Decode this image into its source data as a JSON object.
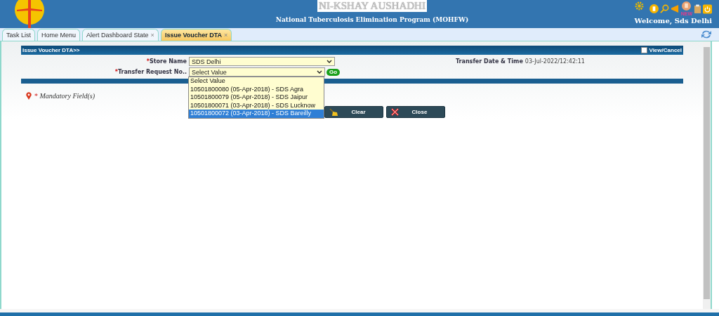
{
  "header": {
    "title": "NI-KSHAY AUSHADHI",
    "subtitle": "National Tuberculosis Elimination Program (MOHFW)",
    "new_badge": "NEW",
    "welcome": "Welcome, Sds Delhi"
  },
  "tabs": [
    {
      "label": "Task List",
      "selected": false,
      "closable": false
    },
    {
      "label": "Home Menu",
      "selected": false,
      "closable": false
    },
    {
      "label": "Alert Dashboard State",
      "selected": false,
      "closable": true
    },
    {
      "label": "Issue Voucher DTA",
      "selected": true,
      "closable": true
    }
  ],
  "close_glyph": "×",
  "form": {
    "title": "Issue Voucher DTA>>",
    "view_cancel": {
      "label": "View/Cancel",
      "checked": false
    },
    "store_name": {
      "label": "Store Name",
      "value": "SDS Delhi"
    },
    "transfer_request": {
      "label": "Transfer Request No..",
      "value": "Select Value",
      "go": "Go"
    },
    "transfer_date": {
      "label": "Transfer Date & Time",
      "value": "03-Jul-2022/12:42:11"
    },
    "required_mark": "*",
    "dropdown_options": [
      {
        "label": "Select Value",
        "selected": false
      },
      {
        "label": "10501800080 (05-Apr-2018) - SDS Agra",
        "selected": false
      },
      {
        "label": "10501800079 (05-Apr-2018) - SDS Jaipur",
        "selected": false
      },
      {
        "label": "10501800071 (03-Apr-2018) - SDS Lucknow",
        "selected": false
      },
      {
        "label": "10501800072 (03-Apr-2018) - SDS Bareilly",
        "selected": true
      }
    ],
    "mandatory_note": "Mandatory Field(s)",
    "buttons": [
      {
        "kind": "clear",
        "label": "Clear"
      },
      {
        "kind": "close",
        "label": "Close"
      }
    ]
  }
}
